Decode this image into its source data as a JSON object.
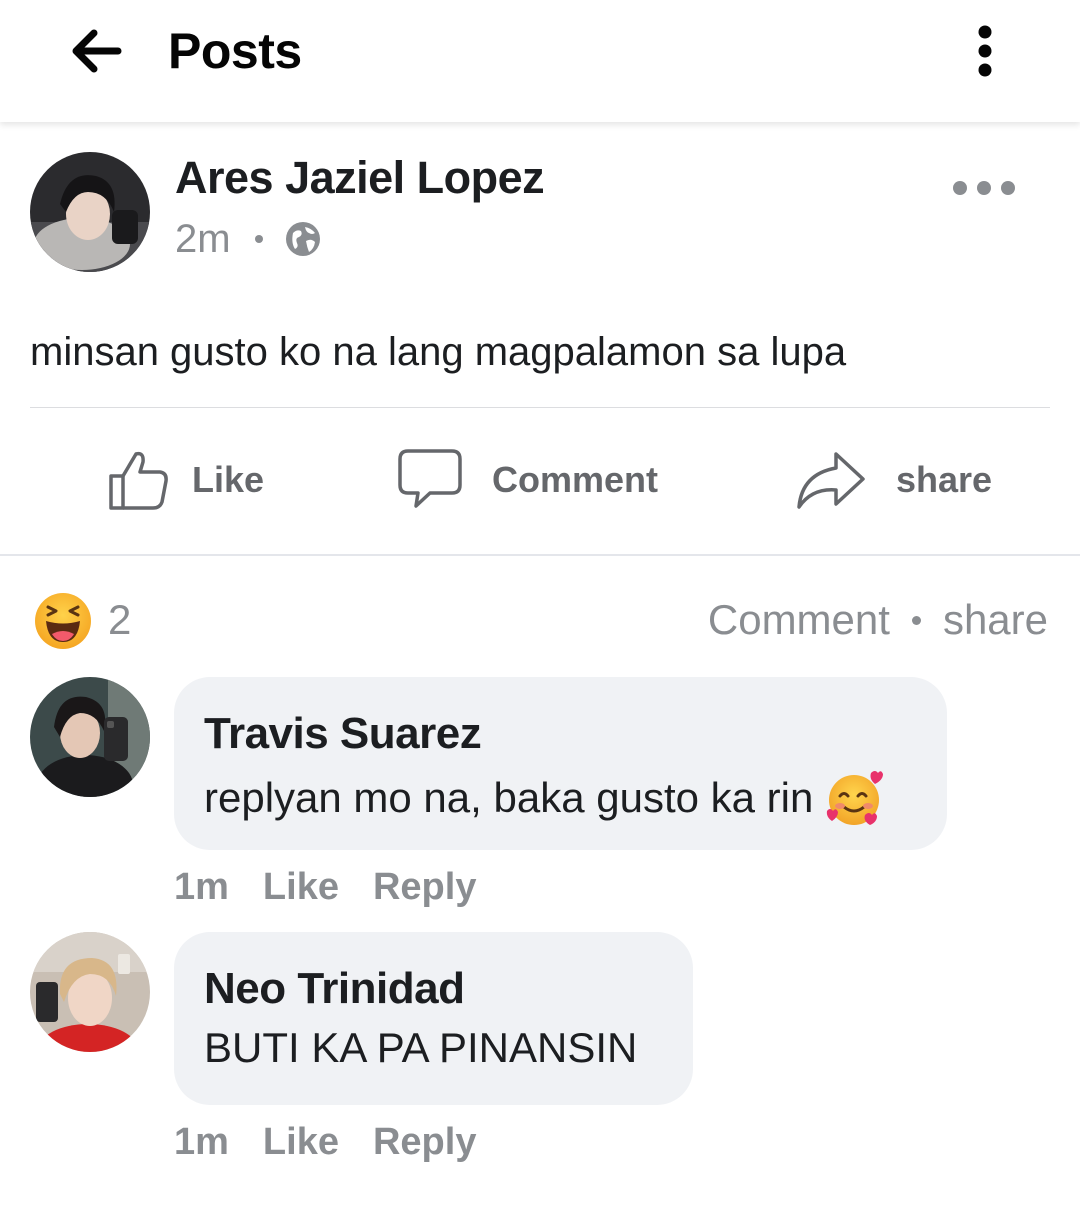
{
  "header": {
    "title": "Posts",
    "back_icon": "arrow-left-icon",
    "menu_icon": "kebab-vertical-icon"
  },
  "post": {
    "author": "Ares Jaziel Lopez",
    "time": "2m",
    "privacy_icon": "globe-icon",
    "text": "minsan gusto ko na lang magpalamon sa lupa",
    "actions": {
      "like": "Like",
      "comment": "Comment",
      "share": "share"
    },
    "reactions": {
      "emoji": "laughing-emoji-icon",
      "count": "2"
    },
    "summary": {
      "comment": "Comment",
      "share": "share"
    }
  },
  "comments": [
    {
      "author": "Travis Suarez",
      "text": "replyan mo na, baka gusto ka rin",
      "emoji": "smiling-face-with-hearts-icon",
      "time": "1m",
      "like": "Like",
      "reply": "Reply"
    },
    {
      "author": "Neo Trinidad",
      "text": "BUTI KA PA PINANSIN",
      "time": "1m",
      "like": "Like",
      "reply": "Reply"
    }
  ],
  "colors": {
    "text_primary": "#1c1e21",
    "text_secondary": "#8a8d91",
    "action_gray": "#65676b",
    "bubble_bg": "#f0f2f5",
    "divider": "#dcdde0"
  }
}
